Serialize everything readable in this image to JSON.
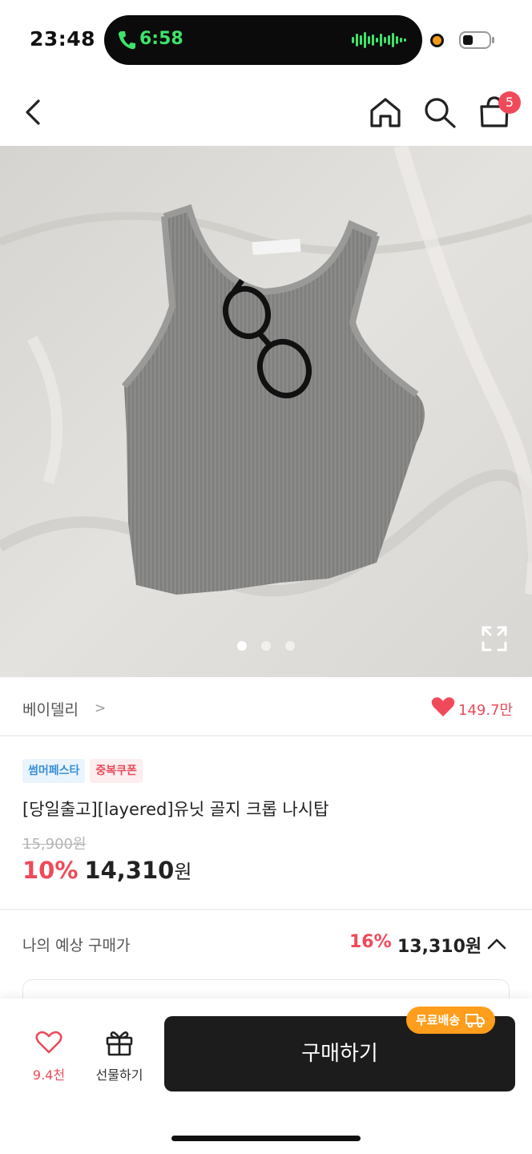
{
  "status_bar": {
    "time": "23:48",
    "call_time": "6:58",
    "icons": [
      "phone-icon",
      "audio-wave-icon",
      "recording-dot-icon",
      "battery-icon"
    ]
  },
  "nav": {
    "icons": [
      "back-icon",
      "home-icon",
      "search-icon",
      "cart-icon"
    ],
    "cart_count": "5"
  },
  "gallery": {
    "image_count": 3,
    "active_index": 0
  },
  "brand": {
    "name": "베이델리",
    "chevron": ">",
    "likes": "149.7만"
  },
  "product": {
    "tags": [
      "썸머페스타",
      "중복쿠폰"
    ],
    "title": "[당일출고][layered]유닛 골지 크롭 나시탑",
    "original_price": "15,900원",
    "discount_rate": "10%",
    "sale_price": "14,310",
    "currency": "원"
  },
  "expected_price": {
    "label": "나의 예상 구매가",
    "discount_rate": "16%",
    "price": "13,310원"
  },
  "bottom_bar": {
    "wish_count": "9.4천",
    "gift_label": "선물하기",
    "buy_label": "구매하기",
    "free_shipping_badge": "무료배송"
  },
  "colors": {
    "accent_red": "#f04a5a",
    "badge_orange": "#ff9d1c",
    "buy_button": "#1c1c1c",
    "call_green": "#3ee36a"
  }
}
